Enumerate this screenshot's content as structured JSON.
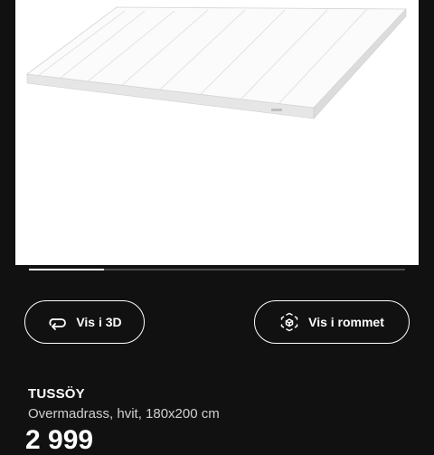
{
  "carousel": {
    "image_alt": "TUSSÖY overmadrass",
    "progress": 0.2
  },
  "buttons": {
    "view_3d": {
      "label": "Vis i 3D",
      "icon": "rotate-3d-icon"
    },
    "view_room": {
      "label": "Vis i rommet",
      "icon": "ar-cube-icon"
    }
  },
  "product": {
    "name": "TUSSÖY",
    "description": "Overmadrass, hvit, 180x200 cm",
    "price": "2 999"
  }
}
